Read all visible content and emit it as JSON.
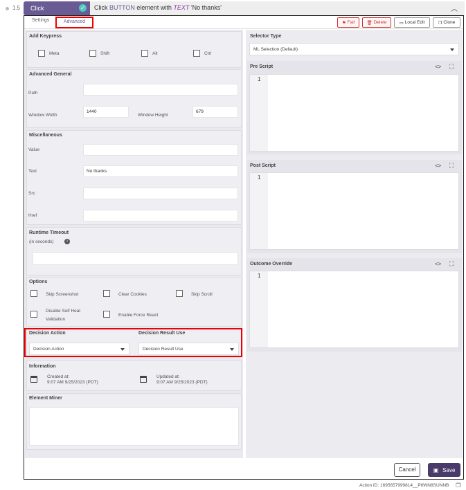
{
  "step": {
    "number": "1.5",
    "action": "Click",
    "desc_prefix": "Click",
    "desc_type": "BUTTON",
    "desc_mid": "element with",
    "desc_by": "TEXT",
    "desc_value": "'No thanks'"
  },
  "tabs": {
    "settings": "Settings",
    "advanced": "Advanced"
  },
  "toolbar": {
    "fail": "Fail",
    "delete": "Delete",
    "local_edit": "Local Edit",
    "clone": "Clone"
  },
  "keypress": {
    "title": "Add Keypress",
    "keys": [
      "Meta",
      "Shift",
      "Alt",
      "Ctrl"
    ]
  },
  "advanced_general": {
    "title": "Advanced General",
    "path_label": "Path",
    "path_value": "",
    "window_width_label": "Window Width",
    "window_width_value": "1440",
    "window_height_label": "Window Height",
    "window_height_value": "679"
  },
  "misc": {
    "title": "Miscellaneous",
    "value_label": "Value",
    "text_label": "Text",
    "text_value": "No thanks",
    "src_label": "Src",
    "href_label": "Href"
  },
  "runtime": {
    "title": "Runtime Timeout",
    "sub": "(in seconds)"
  },
  "options": {
    "title": "Options",
    "skip_screenshot": "Skip Screenshot",
    "clear_cookies": "Clear Cookies",
    "skip_scroll": "Skip Scroll",
    "disable_self_heal_1": "Disable Self Heal",
    "disable_self_heal_2": "Validation",
    "enable_force_react": "Enable Force React"
  },
  "decision": {
    "action_label": "Decision Action",
    "action_value": "Decision Action",
    "result_label": "Decision Result Use",
    "result_value": "Decision Result Use"
  },
  "information": {
    "title": "Information",
    "created_label": "Created at:",
    "created_value": "9:07 AM 9/25/2023 (PDT)",
    "updated_label": "Updated at:",
    "updated_value": "9:07 AM 9/25/2023 (PDT)"
  },
  "element_miner": {
    "title": "Element Miner"
  },
  "selector": {
    "title": "Selector Type",
    "value": "ML Selection (Default)"
  },
  "pre_script": {
    "title": "Pre Script",
    "line": "1"
  },
  "post_script": {
    "title": "Post Script",
    "line": "1"
  },
  "outcome": {
    "title": "Outcome Override",
    "line": "1"
  },
  "buttons": {
    "cancel": "Cancel",
    "save": "Save"
  },
  "footer": {
    "action_id": "Action ID: 1695657999814__P6WN8SUNNB"
  },
  "colors": {
    "accent": "#6b5b95",
    "highlight": "#e00000",
    "check": "#4ec9c0"
  }
}
